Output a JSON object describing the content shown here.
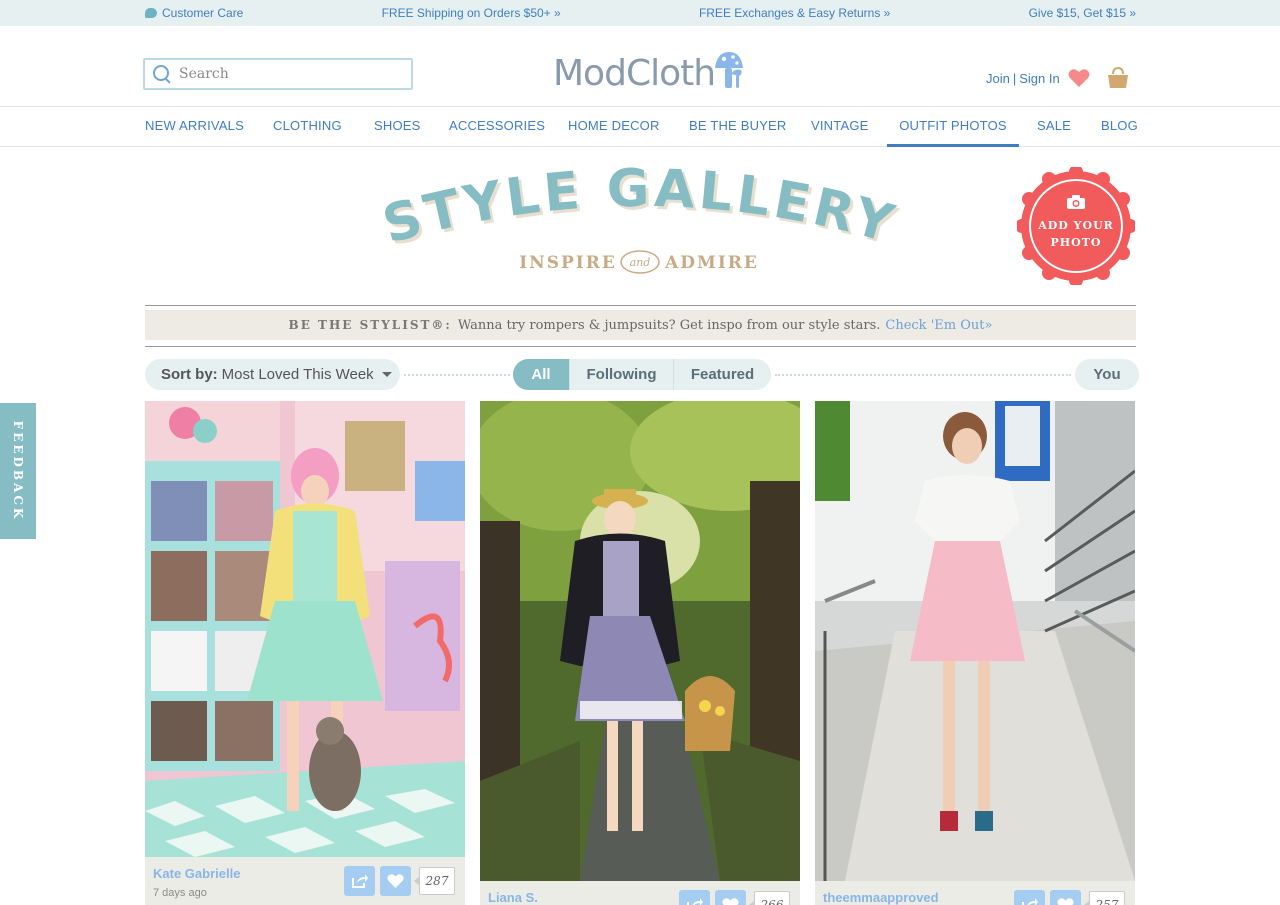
{
  "promo_bar": {
    "customer_care": "Customer Care",
    "shipping": "FREE Shipping on Orders $50+ »",
    "exchanges": "FREE Exchanges & Easy Returns »",
    "referral": "Give $15, Get $15 »"
  },
  "header": {
    "search_placeholder": "Search",
    "logo_text": "ModCloth",
    "join": "Join",
    "sign_in": "Sign In",
    "separator": "|"
  },
  "nav": {
    "items": [
      {
        "label": "NEW ARRIVALS"
      },
      {
        "label": "CLOTHING"
      },
      {
        "label": "SHOES"
      },
      {
        "label": "ACCESSORIES"
      },
      {
        "label": "HOME DECOR"
      },
      {
        "label": "BE THE BUYER"
      },
      {
        "label": "VINTAGE"
      },
      {
        "label": "OUTFIT PHOTOS",
        "active": true
      },
      {
        "label": "SALE"
      },
      {
        "label": "BLOG"
      }
    ]
  },
  "hero": {
    "title": "STYLE GALLERY",
    "tagline_left": "INSPIRE",
    "tagline_and": "and",
    "tagline_right": "ADMIRE",
    "badge_line1": "ADD YOUR",
    "badge_line2": "PHOTO"
  },
  "stylist": {
    "lead": "BE THE STYLIST®:",
    "message": "Wanna try rompers & jumpsuits? Get inspo from our style stars.",
    "link": "Check 'Em Out»"
  },
  "filters": {
    "sort_label": "Sort by:",
    "sort_value": "Most Loved This Week",
    "segments": [
      "All",
      "Following",
      "Featured"
    ],
    "selected_segment": "All",
    "you": "You"
  },
  "feedback_label": "FEEDBACK",
  "cards": [
    {
      "author": "Kate Gabrielle",
      "age": "7 days ago",
      "count": "287"
    },
    {
      "author": "Liana S.",
      "age": "",
      "count": "266"
    },
    {
      "author": "theemmaapproved",
      "age": "",
      "count": "257"
    }
  ],
  "colors": {
    "link_blue": "#3f7ec3",
    "teal": "#86bcc4",
    "badge_red": "#f25b5b",
    "promo_bg": "#e6f0f1",
    "heart_pink": "#f58a8c",
    "bag_tan": "#d2a86e"
  }
}
